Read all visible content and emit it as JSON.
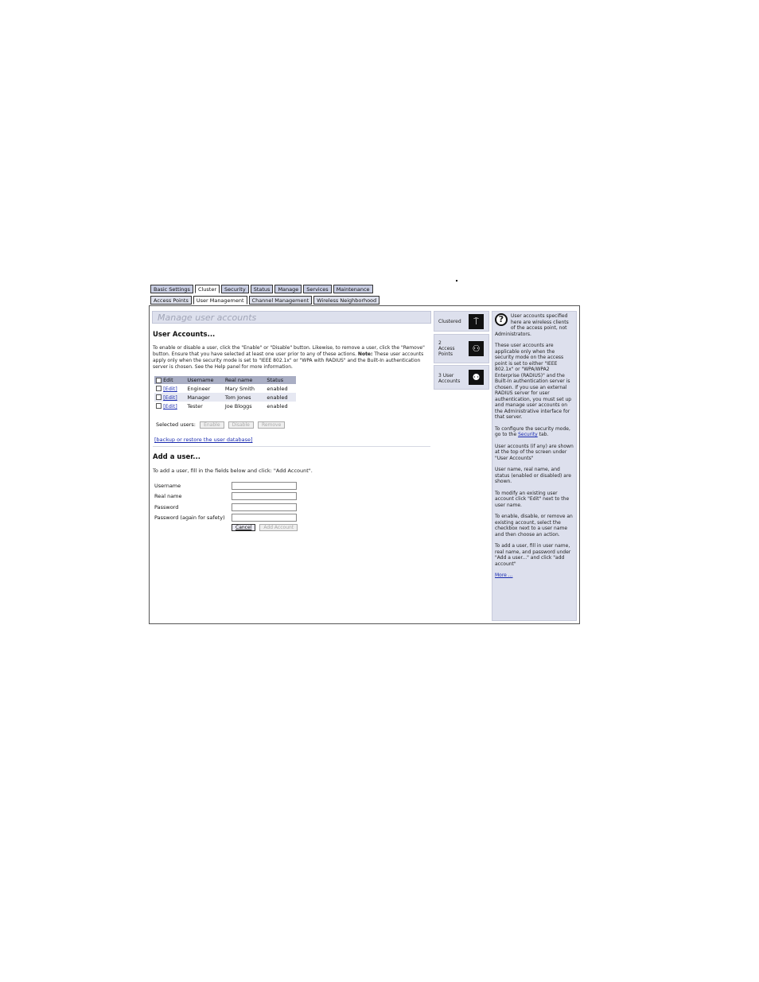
{
  "main_tabs": [
    "Basic Settings",
    "Cluster",
    "Security",
    "Status",
    "Manage",
    "Services",
    "Maintenance"
  ],
  "sub_tabs": [
    "Access Points",
    "User Management",
    "Channel Management",
    "Wireless Neighborhood"
  ],
  "page_title": "Manage user accounts",
  "accounts": {
    "heading": "User Accounts...",
    "intro": "To enable or disable a user, click the \"Enable\" or \"Disable\" button. Likewise, to remove a user, click the \"Remove\" button. Ensure that you have selected at least one user prior to any of these actions.",
    "note_label": "Note:",
    "note_text": "These user accounts apply only when the security mode is set to \"IEEE 802.1x\" or \"WPA with RADIUS\" and the Built-In authentication server is chosen. See the Help panel for more information.",
    "columns": [
      "Edit",
      "Username",
      "Real name",
      "Status"
    ],
    "rows": [
      {
        "edit": "[Edit]",
        "username": "Engineer",
        "realname": "Mary Smith",
        "status": "enabled"
      },
      {
        "edit": "[Edit]",
        "username": "Manager",
        "realname": "Tom Jones",
        "status": "enabled"
      },
      {
        "edit": "[Edit]",
        "username": "Tester",
        "realname": "Joe Bloggs",
        "status": "enabled"
      }
    ],
    "selected_label": "Selected users:",
    "buttons": {
      "enable": "Enable",
      "disable": "Disable",
      "remove": "Remove"
    },
    "backup_link": "[backup or restore the user database]"
  },
  "add_user": {
    "heading": "Add a user...",
    "intro": "To add a user, fill in the fields below and click: \"Add Account\".",
    "fields": {
      "username": "Username",
      "realname": "Real name",
      "password": "Password",
      "password2": "Password (again for safety)"
    },
    "cancel": "Cancel",
    "add": "Add Account"
  },
  "sidebar": {
    "clustered": "Clustered",
    "access_points": "2\nAccess\nPoints",
    "user_accounts": "3 User\nAccounts"
  },
  "help": {
    "p1": "User accounts specified here are wireless clients of the access point, not Administrators.",
    "p2": "These user accounts are applicable only when the security mode on the access point is set to either \"IEEE 802.1x\" or \"WPA/WPA2 Enterprise (RADIUS)\" and the Built-In authentication server is chosen. If you use an external RADIUS server for user authentication, you must set up and manage user accounts on the Administrative interface for that server.",
    "p3a": "To configure the security mode, go to the",
    "p3link": "Security",
    "p3b": "tab.",
    "p4": "User accounts (if any) are shown at the top of the screen under \"User Accounts\"",
    "p5": "User name, real name, and status (enabled or disabled) are shown.",
    "p6": "To modify an existing user account click \"Edit\" next to the user name.",
    "p7": "To enable, disable, or remove an existing account, select the checkbox next to a user name and then choose an action.",
    "p8": "To add a user, fill in user name, real name, and password under \"Add a user...\" and click \"add account\"",
    "more": "More ..."
  }
}
